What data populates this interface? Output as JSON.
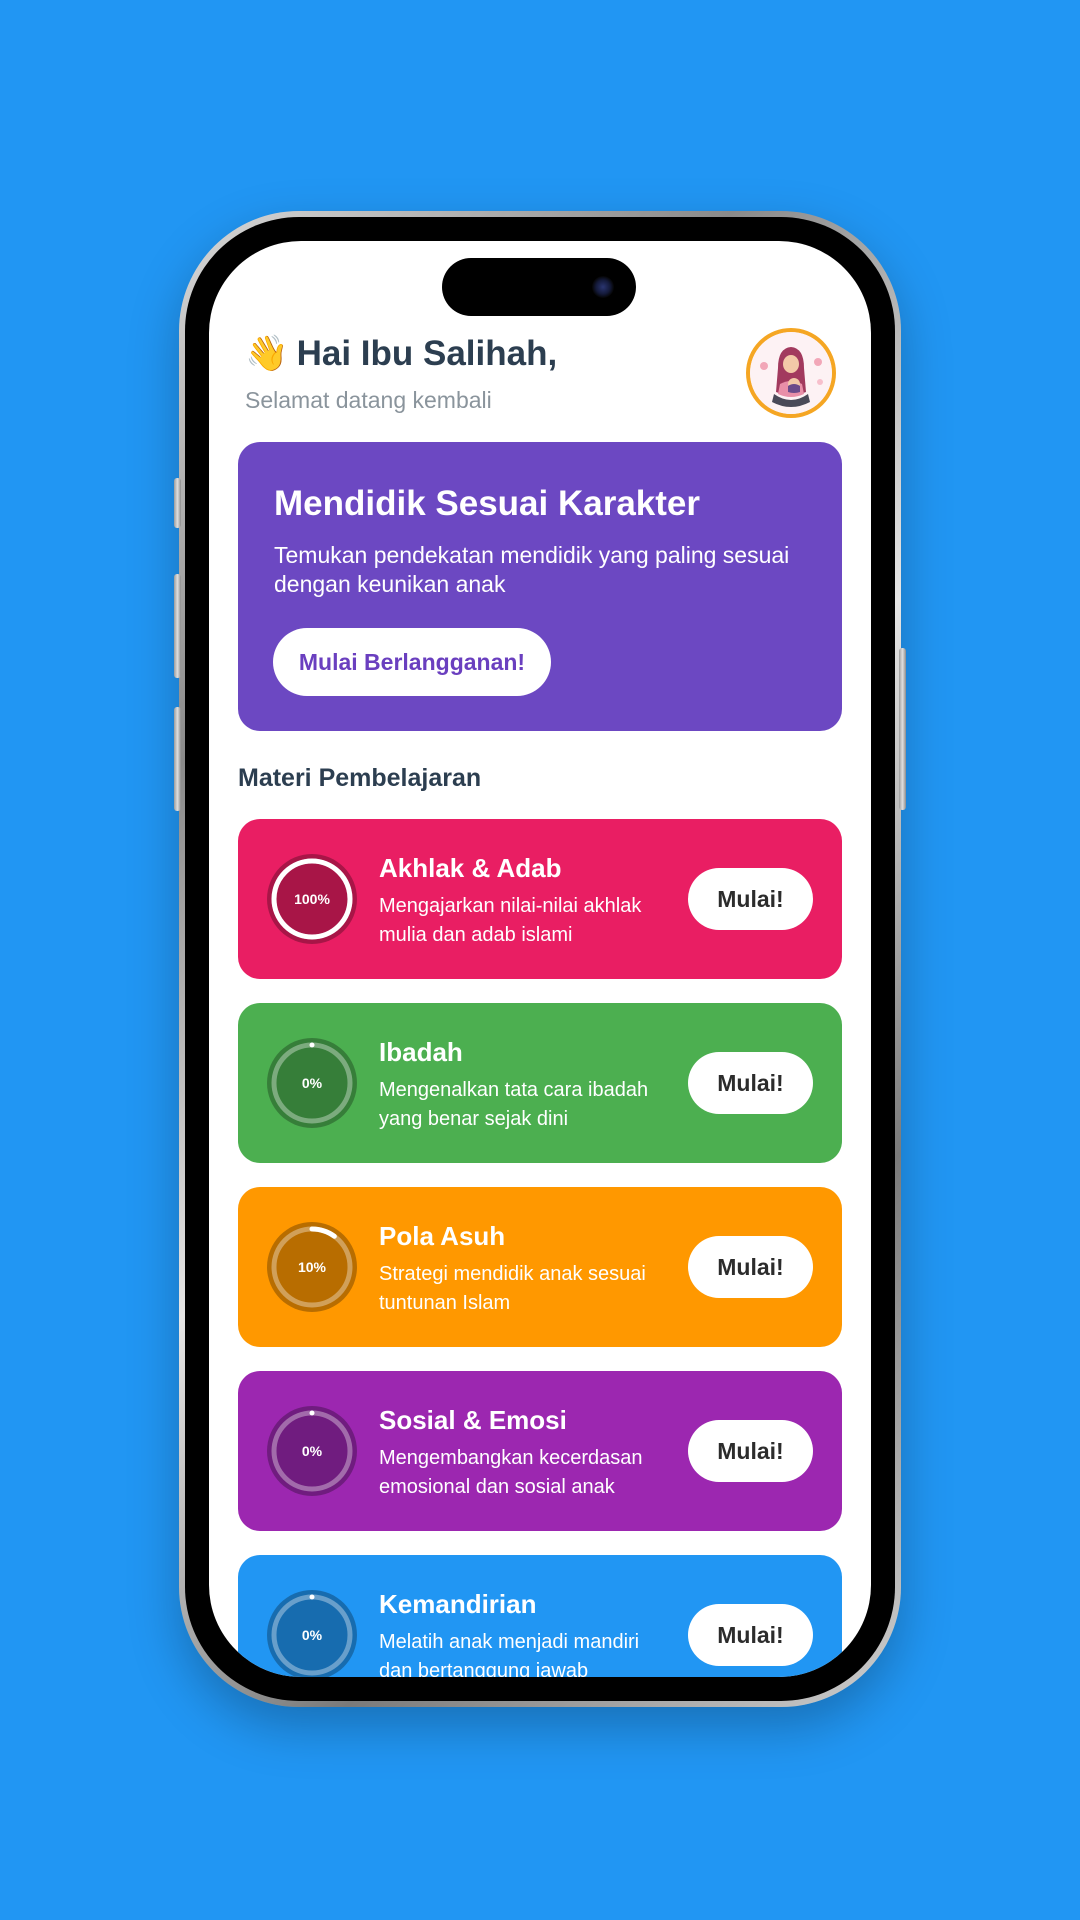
{
  "header": {
    "wave_icon": "👋",
    "greeting": "Hai Ibu Salihah,",
    "subtitle": "Selamat datang kembali"
  },
  "promo": {
    "title": "Mendidik Sesuai Karakter",
    "description": "Temukan pendekatan mendidik yang paling sesuai dengan keunikan anak",
    "button_label": "Mulai Berlangganan!",
    "color": "#6c48c2"
  },
  "section": {
    "title": "Materi Pembelajaran"
  },
  "courses": [
    {
      "title": "Akhlak & Adab",
      "description": "Mengajarkan nilai-nilai akhlak mulia dan adab islami",
      "progress_label": "100%",
      "progress": 1.0,
      "color": "#e91e63",
      "button_label": "Mulai!"
    },
    {
      "title": "Ibadah",
      "description": "Mengenalkan tata cara ibadah yang benar sejak dini",
      "progress_label": "0%",
      "progress": 0.0,
      "color": "#4caf50",
      "button_label": "Mulai!"
    },
    {
      "title": "Pola Asuh",
      "description": "Strategi mendidik anak sesuai tuntunan Islam",
      "progress_label": "10%",
      "progress": 0.1,
      "color": "#ff9800",
      "button_label": "Mulai!"
    },
    {
      "title": "Sosial & Emosi",
      "description": "Mengembangkan kecerdasan emosional dan sosial anak",
      "progress_label": "0%",
      "progress": 0.0,
      "color": "#9c27b0",
      "button_label": "Mulai!"
    },
    {
      "title": "Kemandirian",
      "description": "Melatih anak menjadi mandiri dan bertanggung jawab",
      "progress_label": "0%",
      "progress": 0.0,
      "color": "#2196f3",
      "button_label": "Mulai!"
    }
  ]
}
